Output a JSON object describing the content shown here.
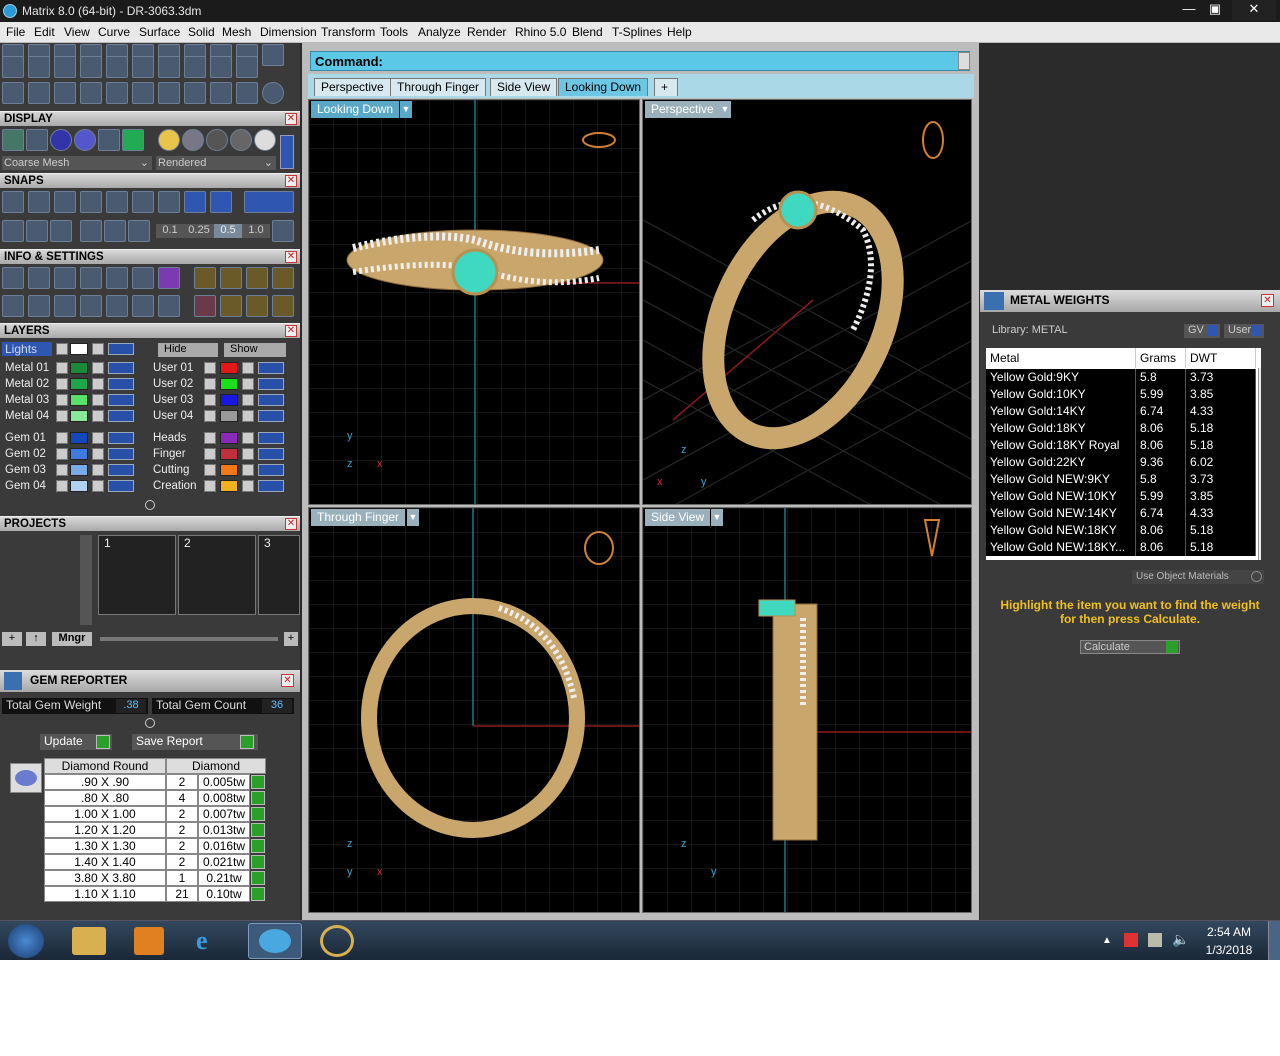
{
  "window": {
    "title": "Matrix 8.0 (64-bit) - DR-3063.3dm",
    "min": "—",
    "max": "▣",
    "close": "✕"
  },
  "menu": [
    "File",
    "Edit",
    "View",
    "Curve",
    "Surface",
    "Solid",
    "Mesh",
    "Dimension",
    "Transform",
    "Tools",
    "Analyze",
    "Render",
    "Rhino 5.0",
    "Blend",
    "T-Splines",
    "Help"
  ],
  "display": {
    "title": "DISPLAY",
    "mesh": "Coarse Mesh",
    "mode": "Rendered"
  },
  "snaps": {
    "title": "SNAPS",
    "values": [
      "0.1",
      "0.25",
      "0.5",
      "1.0"
    ]
  },
  "info": {
    "title": "INFO & SETTINGS"
  },
  "layers": {
    "title": "LAYERS",
    "lights": "Lights",
    "hide": "Hide",
    "show": "Show",
    "left": [
      {
        "name": "Metal 01",
        "color": "#1a8a3a"
      },
      {
        "name": "Metal 02",
        "color": "#1fa64a"
      },
      {
        "name": "Metal 03",
        "color": "#59e06a"
      },
      {
        "name": "Metal 04",
        "color": "#8ae89a"
      },
      {
        "name": "Gem 01",
        "color": "#1448b8"
      },
      {
        "name": "Gem 02",
        "color": "#3e7ae0"
      },
      {
        "name": "Gem 03",
        "color": "#7aaae8"
      },
      {
        "name": "Gem 04",
        "color": "#b0d0f0"
      }
    ],
    "right": [
      {
        "name": "User 01",
        "color": "#e01818"
      },
      {
        "name": "User 02",
        "color": "#1ae01a"
      },
      {
        "name": "User 03",
        "color": "#1818e0"
      },
      {
        "name": "User 04",
        "color": "#9a9a9a"
      },
      {
        "name": "Heads",
        "color": "#8a28b8"
      },
      {
        "name": "Finger",
        "color": "#c0303a"
      },
      {
        "name": "Cutting",
        "color": "#f07818"
      },
      {
        "name": "Creation",
        "color": "#f0b020"
      }
    ]
  },
  "projects": {
    "title": "PROJECTS",
    "slots": [
      "1",
      "2",
      "3"
    ],
    "mngr": "Mngr"
  },
  "gem_reporter": {
    "title": "GEM REPORTER",
    "total_weight_label": "Total Gem Weight",
    "total_weight": ".38",
    "total_count_label": "Total Gem Count",
    "total_count": "36",
    "update": "Update",
    "save": "Save Report",
    "col1": "Diamond Round",
    "col2": "Diamond",
    "rows": [
      {
        "size": ".90 X .90",
        "count": "2",
        "tw": "0.005tw"
      },
      {
        "size": ".80 X .80",
        "count": "4",
        "tw": "0.008tw"
      },
      {
        "size": "1.00 X 1.00",
        "count": "2",
        "tw": "0.007tw"
      },
      {
        "size": "1.20 X 1.20",
        "count": "2",
        "tw": "0.013tw"
      },
      {
        "size": "1.30 X 1.30",
        "count": "2",
        "tw": "0.016tw"
      },
      {
        "size": "1.40 X 1.40",
        "count": "2",
        "tw": "0.021tw"
      },
      {
        "size": "3.80 X 3.80",
        "count": "1",
        "tw": "0.21tw"
      },
      {
        "size": "1.10 X 1.10",
        "count": "21",
        "tw": "0.10tw"
      }
    ]
  },
  "command": {
    "label": "Command:"
  },
  "tabs": [
    "Perspective",
    "Through Finger",
    "Side View",
    "Looking Down"
  ],
  "viewports": {
    "top_left": "Looking Down",
    "top_right": "Perspective",
    "bottom_left": "Through Finger",
    "bottom_right": "Side View"
  },
  "axes": {
    "x": "x",
    "y": "y",
    "z": "z"
  },
  "metal_weights": {
    "title": "METAL WEIGHTS",
    "library": "Library: METAL",
    "gv": "GV",
    "user": "User",
    "headers": [
      "Metal",
      "Grams",
      "DWT"
    ],
    "rows": [
      {
        "metal": "Yellow Gold:9KY",
        "grams": "5.8",
        "dwt": "3.73"
      },
      {
        "metal": "Yellow Gold:10KY",
        "grams": "5.99",
        "dwt": "3.85"
      },
      {
        "metal": "Yellow Gold:14KY",
        "grams": "6.74",
        "dwt": "4.33"
      },
      {
        "metal": "Yellow Gold:18KY",
        "grams": "8.06",
        "dwt": "5.18"
      },
      {
        "metal": "Yellow Gold:18KY Royal",
        "grams": "8.06",
        "dwt": "5.18"
      },
      {
        "metal": "Yellow Gold:22KY",
        "grams": "9.36",
        "dwt": "6.02"
      },
      {
        "metal": "Yellow Gold NEW:9KY",
        "grams": "5.8",
        "dwt": "3.73"
      },
      {
        "metal": "Yellow Gold NEW:10KY",
        "grams": "5.99",
        "dwt": "3.85"
      },
      {
        "metal": "Yellow Gold NEW:14KY",
        "grams": "6.74",
        "dwt": "4.33"
      },
      {
        "metal": "Yellow Gold NEW:18KY",
        "grams": "8.06",
        "dwt": "5.18"
      },
      {
        "metal": "Yellow Gold NEW:18KY...",
        "grams": "8.06",
        "dwt": "5.18"
      }
    ],
    "use_object_materials": "Use Object Materials",
    "hint": "Highlight the item you want to find the weight for then press Calculate.",
    "calculate": "Calculate"
  },
  "taskbar": {
    "time": "2:54 AM",
    "date": "1/3/2018"
  }
}
